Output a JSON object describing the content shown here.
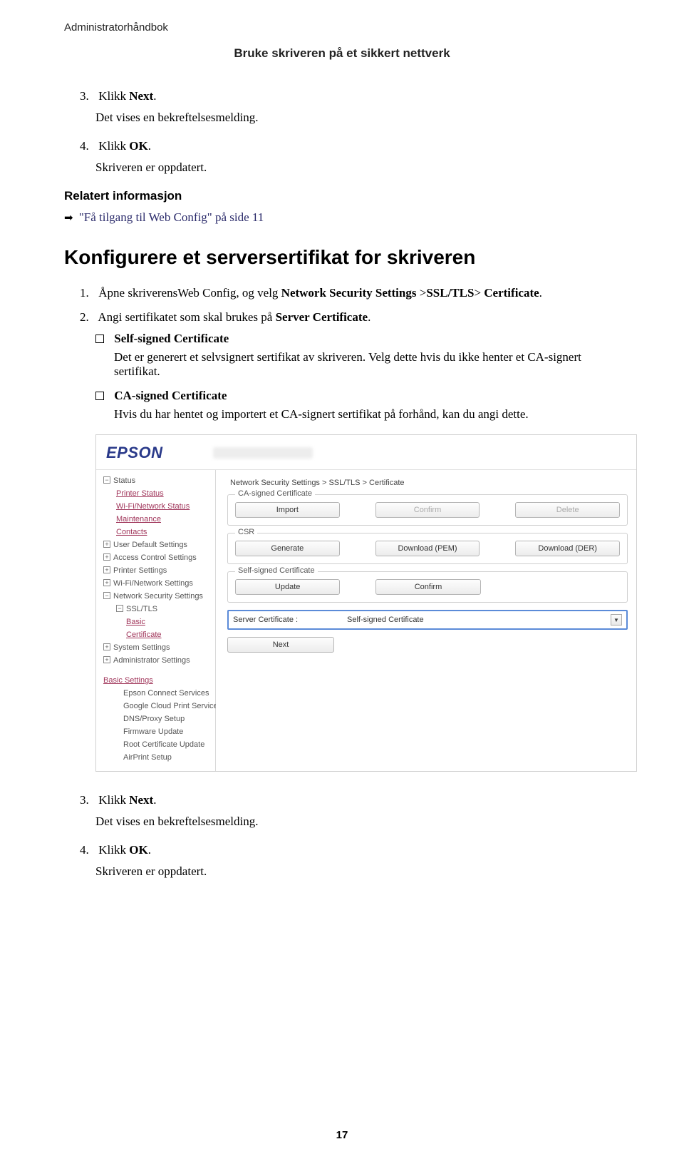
{
  "header": {
    "doc_title": "Administratorhåndbok",
    "chapter": "Bruke skriveren på et sikkert nettverk"
  },
  "steps1": {
    "s3_num": "3.",
    "s3_text_pre": "Klikk ",
    "s3_text_bold": "Next",
    "s3_text_post": ".",
    "s3_sub": "Det vises en bekreftelsesmelding.",
    "s4_num": "4.",
    "s4_text_pre": "Klikk ",
    "s4_text_bold": "OK",
    "s4_text_post": ".",
    "s4_sub": "Skriveren er oppdatert."
  },
  "related": {
    "heading": "Relatert informasjon",
    "link": "\"Få tilgang til Web Config\" på side 11"
  },
  "h2": "Konfigurere et serversertifikat for skriveren",
  "steps2": {
    "s1_num": "1.",
    "s1_a": "Åpne skriverensWeb Config, og velg ",
    "s1_b": "Network Security Settings",
    "s1_c": " >",
    "s1_d": "SSL/TLS",
    "s1_e": "> ",
    "s1_f": "Certificate",
    "s1_g": ".",
    "s2_num": "2.",
    "s2_a": "Angi sertifikatet som skal brukes på ",
    "s2_b": "Server Certificate",
    "s2_c": "."
  },
  "bullets": {
    "b1_title": "Self-signed Certificate",
    "b1_text": "Det er generert et selvsignert sertifikat av skriveren. Velg dette hvis du ikke henter et CA-signert sertifikat.",
    "b2_title": "CA-signed Certificate",
    "b2_text": "Hvis du har hentet og importert et CA-signert sertifikat på forhånd, kan du angi dette."
  },
  "ui": {
    "logo": "EPSON",
    "breadcrumb": "Network Security Settings > SSL/TLS > Certificate",
    "side": {
      "status": "Status",
      "printer_status": "Printer Status",
      "wifi_status": "Wi-Fi/Network Status",
      "maintenance": "Maintenance",
      "contacts": "Contacts",
      "uds": "User Default Settings",
      "acs": "Access Control Settings",
      "ps": "Printer Settings",
      "wns": "Wi-Fi/Network Settings",
      "nss": "Network Security Settings",
      "ssltls": "SSL/TLS",
      "basic": "Basic",
      "certificate": "Certificate",
      "ss": "System Settings",
      "as": "Administrator Settings",
      "bs": "Basic Settings",
      "ecs": "Epson Connect Services",
      "gcps": "Google Cloud Print Services",
      "dns": "DNS/Proxy Setup",
      "fw": "Firmware Update",
      "rcu": "Root Certificate Update",
      "aps": "AirPrint Setup"
    },
    "groups": {
      "ca": "CA-signed Certificate",
      "csr": "CSR",
      "ssc": "Self-signed Certificate"
    },
    "buttons": {
      "import": "Import",
      "confirm": "Confirm",
      "delete": "Delete",
      "generate": "Generate",
      "download_pem": "Download (PEM)",
      "download_der": "Download (DER)",
      "update": "Update",
      "confirm2": "Confirm",
      "next": "Next"
    },
    "select": {
      "label": "Server Certificate :",
      "value": "Self-signed Certificate"
    }
  },
  "steps3": {
    "s3_num": "3.",
    "s3_text_pre": "Klikk ",
    "s3_text_bold": "Next",
    "s3_text_post": ".",
    "s3_sub": "Det vises en bekreftelsesmelding.",
    "s4_num": "4.",
    "s4_text_pre": "Klikk ",
    "s4_text_bold": "OK",
    "s4_text_post": ".",
    "s4_sub": "Skriveren er oppdatert."
  },
  "page_number": "17"
}
